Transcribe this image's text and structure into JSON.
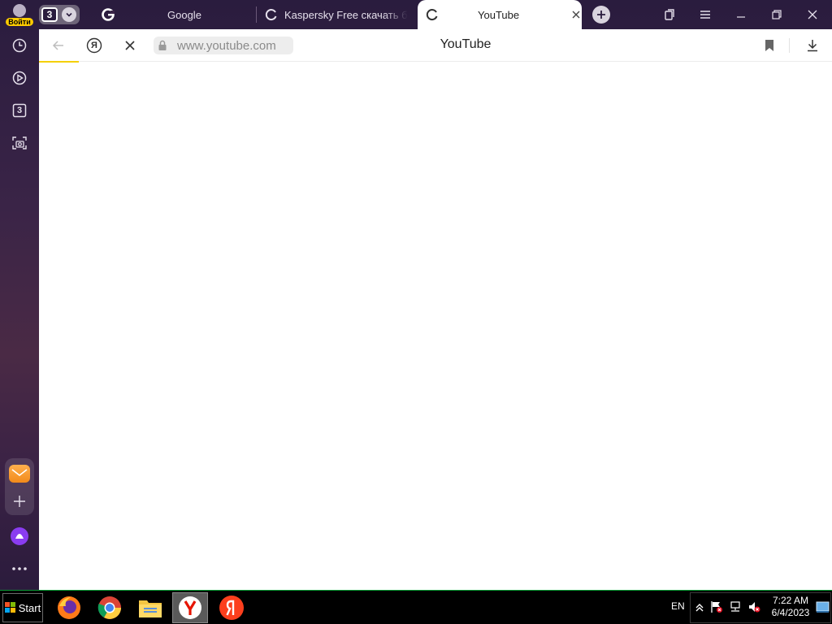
{
  "profile": {
    "login_label": "Войти"
  },
  "tabs": {
    "count": "3",
    "items": [
      {
        "title": "Google",
        "favicon": "google-icon",
        "state": "loaded"
      },
      {
        "title": "Kaspersky Free скачать б",
        "favicon": "loading-icon",
        "state": "loading"
      },
      {
        "title": "YouTube",
        "favicon": "loading-icon",
        "state": "loading",
        "active": true
      }
    ]
  },
  "sidebar": {
    "items": [
      {
        "icon": "history-clock-icon"
      },
      {
        "icon": "play-circle-icon"
      },
      {
        "icon": "tab-count-icon",
        "label": "3"
      },
      {
        "icon": "screenshot-camera-icon"
      },
      {
        "icon": "mail-icon"
      },
      {
        "icon": "add-icon"
      },
      {
        "icon": "alice-assistant-icon"
      },
      {
        "icon": "more-dots-icon"
      }
    ]
  },
  "toolbar": {
    "url": "www.youtube.com",
    "page_title": "YouTube",
    "yandex_button_label": "Я"
  },
  "taskbar": {
    "start_label": "Start",
    "apps": [
      "firefox-icon",
      "chrome-icon",
      "file-explorer-icon",
      "yandex-browser-icon",
      "yandex-icon"
    ],
    "language": "EN",
    "time": "7:22 AM",
    "date": "6/4/2023"
  },
  "colors": {
    "chrome_bg": "#3a2447",
    "accent_yellow": "#f5d000",
    "taskbar_border": "#0a9a33"
  }
}
